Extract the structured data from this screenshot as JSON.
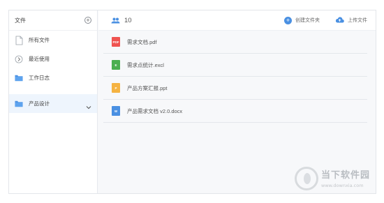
{
  "sidebar": {
    "title": "文件",
    "items": [
      {
        "label": "所有文件",
        "icon": "file-icon"
      },
      {
        "label": "最近使用",
        "icon": "recent-icon"
      },
      {
        "label": "工作日志",
        "icon": "folder-icon"
      },
      {
        "label": "产品设计",
        "icon": "folder-icon"
      }
    ]
  },
  "header": {
    "member_count": "10",
    "create_folder_label": "创建文件夹",
    "upload_label": "上传文件"
  },
  "files": [
    {
      "name": "需求文档.pdf",
      "badge": "PDF",
      "color": "#ef5350"
    },
    {
      "name": "需求点统计.excl",
      "badge": "E",
      "color": "#4caf50"
    },
    {
      "name": "产品方案汇报.ppt",
      "badge": "P",
      "color": "#f5b342"
    },
    {
      "name": "产品需求文档 v2.0.docx",
      "badge": "W",
      "color": "#4a90e2"
    }
  ],
  "watermark": {
    "title": "当下软件园",
    "url": "www.downxia.com"
  },
  "colors": {
    "accent": "#4a90e2",
    "active_bg": "#eef5fd"
  }
}
